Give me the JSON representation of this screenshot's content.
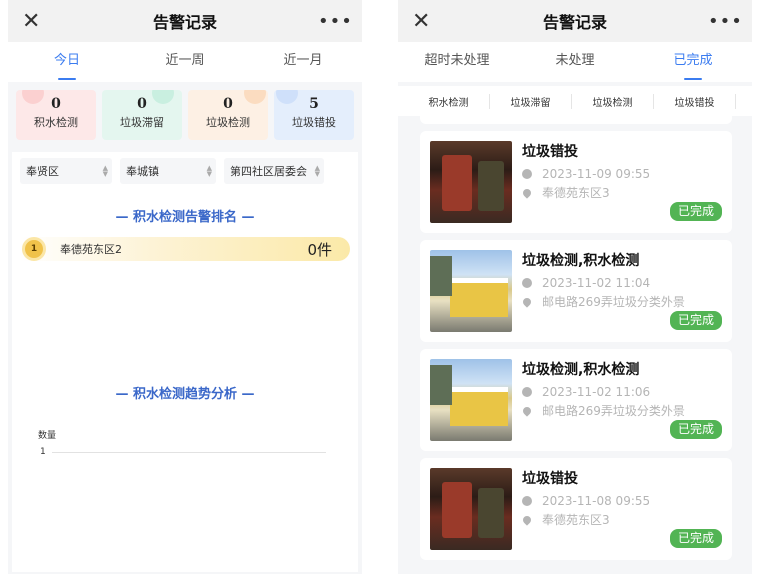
{
  "left": {
    "nav": {
      "close": "✕",
      "title": "告警记录",
      "more": "•••"
    },
    "tabs": [
      "今日",
      "近一周",
      "近一月"
    ],
    "stats": [
      {
        "value": "0",
        "label": "积水检测"
      },
      {
        "value": "0",
        "label": "垃圾滞留"
      },
      {
        "value": "0",
        "label": "垃圾检测"
      },
      {
        "value": "5",
        "label": "垃圾错投"
      }
    ],
    "filters": [
      "奉贤区",
      "奉城镇",
      "第四社区居委会"
    ],
    "ranking_title": "— 积水检测告警排名 —",
    "ranking": [
      {
        "rank": "1",
        "name": "奉德苑东区2",
        "count": "0件"
      }
    ],
    "trend_title": "— 积水检测趋势分析 —",
    "axis_label": "数量",
    "axis_tick": "1"
  },
  "right": {
    "nav": {
      "close": "✕",
      "title": "告警记录",
      "more": "•••"
    },
    "tabs": [
      "超时未处理",
      "未处理",
      "已完成"
    ],
    "chips": [
      "积水检测",
      "垃圾滞留",
      "垃圾检测",
      "垃圾错投"
    ],
    "items": [
      {
        "title": "垃圾错投",
        "time": "2023-11-09 09:55",
        "location": "奉德苑东区3",
        "status": "已完成",
        "thumb": "bin"
      },
      {
        "title": "垃圾检测,积水检测",
        "time": "2023-11-02 11:04",
        "location": "邮电路269弄垃圾分类外景",
        "status": "已完成",
        "thumb": "street"
      },
      {
        "title": "垃圾检测,积水检测",
        "time": "2023-11-02 11:06",
        "location": "邮电路269弄垃圾分类外景",
        "status": "已完成",
        "thumb": "street"
      },
      {
        "title": "垃圾错投",
        "time": "2023-11-08 09:55",
        "location": "奉德苑东区3",
        "status": "已完成",
        "thumb": "bin"
      }
    ],
    "colors": {
      "accent": "#3b7cf0",
      "done": "#52b454"
    }
  }
}
